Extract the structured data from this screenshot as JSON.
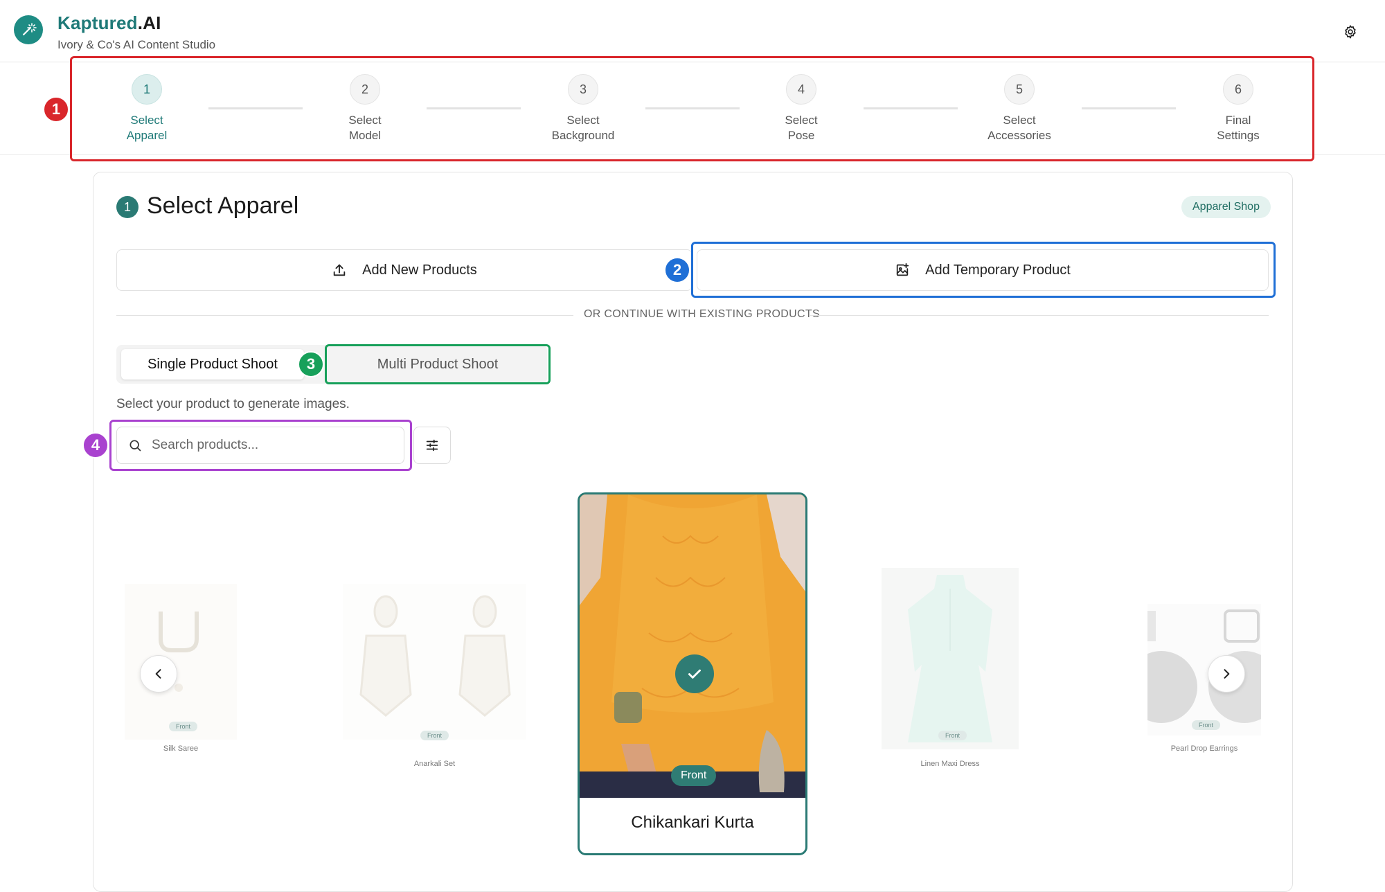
{
  "app": {
    "brand_main": "Kaptured",
    "brand_suffix": ".AI",
    "subtitle": "Ivory & Co's AI Content Studio"
  },
  "stepper": {
    "steps": [
      {
        "number": "1",
        "line1": "Select",
        "line2": "Apparel",
        "active": true
      },
      {
        "number": "2",
        "line1": "Select",
        "line2": "Model",
        "active": false
      },
      {
        "number": "3",
        "line1": "Select",
        "line2": "Background",
        "active": false
      },
      {
        "number": "4",
        "line1": "Select",
        "line2": "Pose",
        "active": false
      },
      {
        "number": "5",
        "line1": "Select",
        "line2": "Accessories",
        "active": false
      },
      {
        "number": "6",
        "line1": "Final",
        "line2": "Settings",
        "active": false
      }
    ]
  },
  "annotations": [
    {
      "number": "1",
      "color": "#d9262b"
    },
    {
      "number": "2",
      "color": "#1f6fd6"
    },
    {
      "number": "3",
      "color": "#17a05a"
    },
    {
      "number": "4",
      "color": "#a942cf"
    }
  ],
  "section": {
    "number": "1",
    "title": "Select Apparel",
    "tag": "Apparel Shop"
  },
  "actions": {
    "add_new": "Add New Products",
    "add_temp": "Add Temporary Product"
  },
  "divider_text": "OR CONTINUE WITH EXISTING PRODUCTS",
  "shoot_toggle": {
    "single": "Single Product Shoot",
    "multi": "Multi Product Shoot",
    "selected": "Single Product Shoot"
  },
  "hint": "Select your product to generate images.",
  "search": {
    "placeholder": "Search products...",
    "value": ""
  },
  "carousel": {
    "products": [
      {
        "name": "Silk Saree",
        "badge": "Front"
      },
      {
        "name": "Anarkali Set",
        "badge": "Front"
      },
      {
        "name": "Chikankari Kurta",
        "badge": "Front",
        "selected": true
      },
      {
        "name": "Linen Maxi Dress",
        "badge": "Front"
      },
      {
        "name": "Pearl Drop Earrings",
        "badge": "Front"
      }
    ]
  },
  "colors": {
    "brand_teal": "#1f7a78",
    "selected_teal": "#2a7a74"
  }
}
